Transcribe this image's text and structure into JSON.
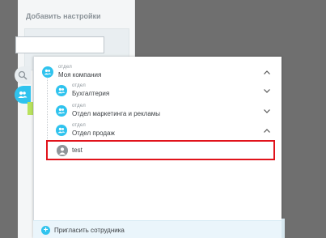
{
  "settings_panel": {
    "title": "Добавить настройки",
    "input_value": ""
  },
  "structure": {
    "root": {
      "type_label": "отдел",
      "name": "Моя компания",
      "expanded": true
    },
    "departments": [
      {
        "type_label": "отдел",
        "name": "Бухгалтерия",
        "expanded": false
      },
      {
        "type_label": "отдел",
        "name": "Отдел маркетинга и рекламы",
        "expanded": false
      },
      {
        "type_label": "отдел",
        "name": "Отдел продаж",
        "expanded": true
      }
    ],
    "employees": [
      {
        "name": "test",
        "selected": true
      }
    ]
  },
  "footer": {
    "invite_label": "Пригласить сотрудника"
  },
  "colors": {
    "accent": "#2fc3ee",
    "highlight": "#e1131b",
    "overlay": "#6f6f6f"
  }
}
